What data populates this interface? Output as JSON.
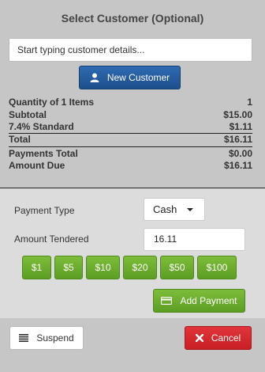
{
  "dialog": {
    "title": "Select Customer (Optional)"
  },
  "customer_search": {
    "placeholder": "Start typing customer details..."
  },
  "new_customer_button": {
    "label": "New Customer",
    "icon": "user-icon"
  },
  "summary": {
    "rows": [
      {
        "label": "Quantity of 1 Items",
        "value": "1"
      },
      {
        "label": "Subtotal",
        "value": "$15.00"
      },
      {
        "label": "7.4% Standard",
        "value": "$1.11"
      },
      {
        "label": "Total",
        "value": "$16.11"
      },
      {
        "label": "Payments Total",
        "value": "$0.00"
      },
      {
        "label": "Amount Due",
        "value": "$16.11"
      }
    ]
  },
  "payment": {
    "type_label": "Payment Type",
    "type_value": "Cash",
    "tendered_label": "Amount Tendered",
    "tendered_value": "16.11",
    "quick_amounts": [
      "$1",
      "$5",
      "$10",
      "$20",
      "$50",
      "$100"
    ],
    "add_button_label": "Add Payment",
    "add_button_icon": "credit-card-icon"
  },
  "footer": {
    "suspend_label": "Suspend",
    "suspend_icon": "list-icon",
    "cancel_label": "Cancel",
    "cancel_icon": "close-icon"
  },
  "colors": {
    "primary": "#1d4f8c",
    "success": "#5c9e23",
    "danger": "#c81e24",
    "panel_bg": "#c6c6c6",
    "payment_bg": "#dcdcdc"
  }
}
